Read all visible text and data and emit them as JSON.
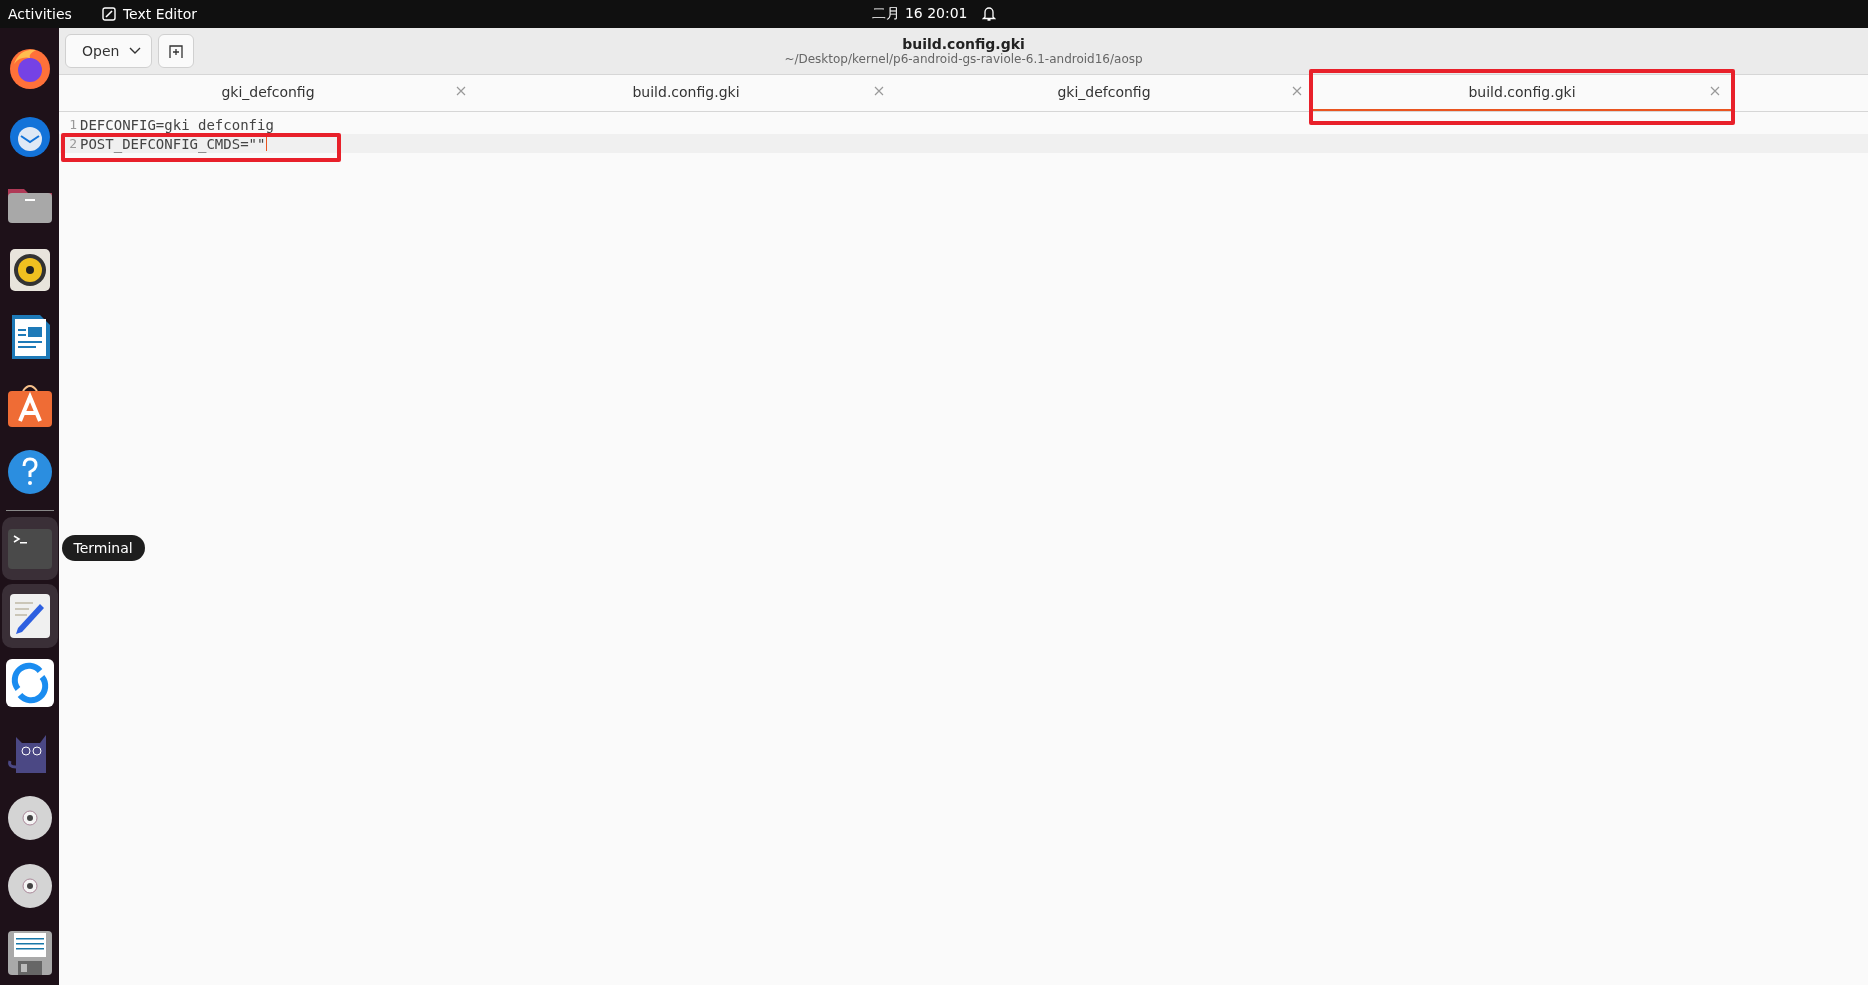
{
  "top_bar": {
    "activities": "Activities",
    "app_name": "Text Editor",
    "clock": "二月 16  20:01"
  },
  "dock": {
    "items": [
      {
        "kind": "firefox",
        "highlighted": false
      },
      {
        "kind": "thunderbird",
        "highlighted": false
      },
      {
        "kind": "files",
        "highlighted": false
      },
      {
        "kind": "speaker",
        "highlighted": false
      },
      {
        "kind": "writer",
        "highlighted": false
      },
      {
        "kind": "store",
        "highlighted": false
      },
      {
        "kind": "help",
        "highlighted": false
      },
      {
        "kind": "separator"
      },
      {
        "kind": "terminal",
        "highlighted": true,
        "tooltip": "Terminal"
      },
      {
        "kind": "editor",
        "highlighted": true
      },
      {
        "kind": "sync",
        "highlighted": false
      },
      {
        "kind": "cat",
        "highlighted": false
      },
      {
        "kind": "disc",
        "highlighted": false
      },
      {
        "kind": "disc",
        "highlighted": false
      },
      {
        "kind": "floppy",
        "highlighted": false
      }
    ]
  },
  "header": {
    "open_button": "Open",
    "title": "build.config.gki",
    "subtitle": "~/Desktop/kernel/p6-android-gs-raviole-6.1-android16/aosp"
  },
  "tabs": [
    {
      "label": "gki_defconfig",
      "selected": false,
      "marked": false
    },
    {
      "label": "build.config.gki",
      "selected": false,
      "marked": false
    },
    {
      "label": "gki_defconfig",
      "selected": false,
      "marked": false
    },
    {
      "label": "build.config.gki",
      "selected": true,
      "marked": true
    }
  ],
  "editor": {
    "lines": [
      {
        "number": "1",
        "text": "DEFCONFIG=gki_defconfig",
        "current": false,
        "marked": false
      },
      {
        "number": "2",
        "text": "POST_DEFCONFIG_CMDS=\"\"",
        "current": true,
        "marked": true
      }
    ]
  }
}
